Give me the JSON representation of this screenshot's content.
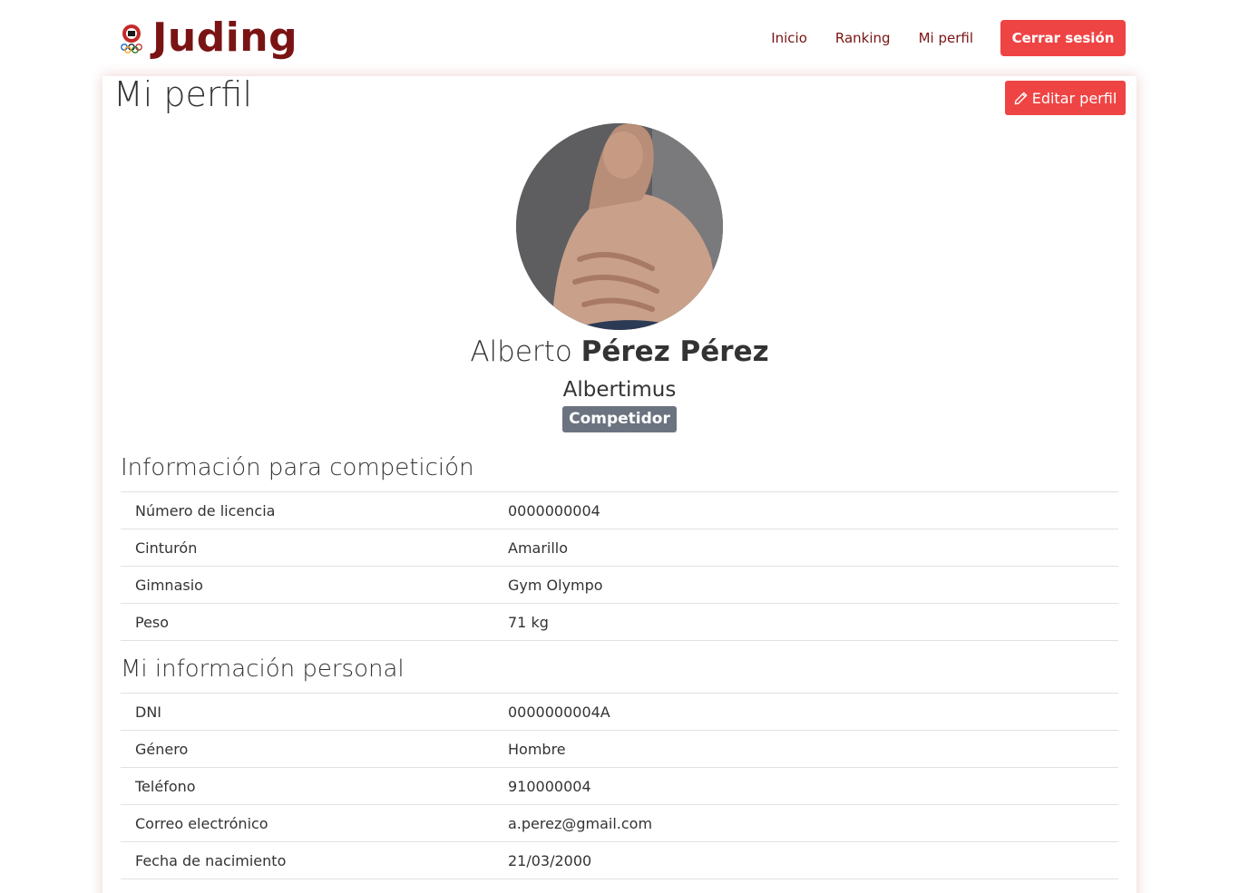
{
  "brand": {
    "name": "Juding",
    "logo": "judo-federation-logo"
  },
  "nav": {
    "links": [
      "Inicio",
      "Ranking",
      "Mi perfil"
    ],
    "logout_label": "Cerrar sesión"
  },
  "page": {
    "title": "Mi perfil",
    "edit_label": "Editar perfil",
    "edit_icon": "pencil-icon"
  },
  "profile": {
    "first_name": "Alberto",
    "last_name": "Pérez Pérez",
    "nickname": "Albertimus",
    "role": "Competidor"
  },
  "competition": {
    "title": "Información para competición",
    "rows": [
      {
        "label": "Número de licencia",
        "value": "0000000004"
      },
      {
        "label": "Cinturón",
        "value": "Amarillo"
      },
      {
        "label": "Gimnasio",
        "value": "Gym Olympo"
      },
      {
        "label": "Peso",
        "value": "71 kg"
      }
    ]
  },
  "personal": {
    "title": "Mi información personal",
    "rows": [
      {
        "label": "DNI",
        "value": "0000000004A"
      },
      {
        "label": "Género",
        "value": "Hombre"
      },
      {
        "label": "Teléfono",
        "value": "910000004"
      },
      {
        "label": "Correo electrónico",
        "value": "a.perez@gmail.com"
      },
      {
        "label": "Fecha de nacimiento",
        "value": "21/03/2000"
      }
    ]
  },
  "colors": {
    "accent": "#ef4444",
    "brand": "#7a1414",
    "badge": "#6b7380"
  }
}
